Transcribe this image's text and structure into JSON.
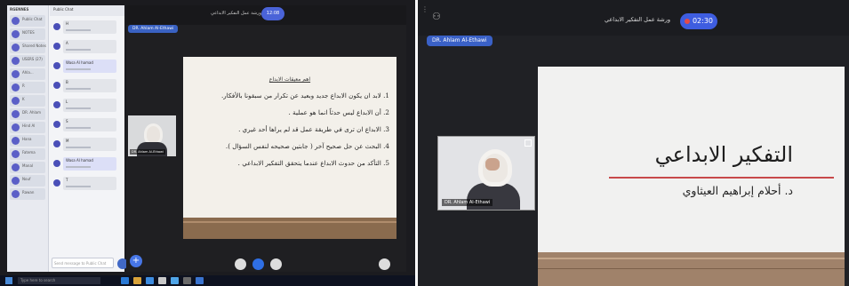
{
  "left": {
    "sidebar": {
      "rail_header": "RGENNES",
      "rail_items": [
        {
          "label": "Public Chat"
        },
        {
          "label": "NOTES"
        },
        {
          "label": "Shared Notes"
        },
        {
          "label": "USERS (27)"
        },
        {
          "label": "Ahla..."
        },
        {
          "label": "R"
        },
        {
          "label": "K"
        },
        {
          "label": "DR. Ahlam"
        },
        {
          "label": "Hind Al"
        },
        {
          "label": "Hana"
        },
        {
          "label": "Fatema"
        },
        {
          "label": "Manal"
        },
        {
          "label": "Nouf"
        },
        {
          "label": "Rawan"
        }
      ],
      "chat_title": "Public Chat",
      "messages": [
        {
          "name": "H",
          "rich": false
        },
        {
          "name": "A",
          "rich": false
        },
        {
          "name": "Wasa Al hamad",
          "rich": true
        },
        {
          "name": "B",
          "rich": false
        },
        {
          "name": "L",
          "rich": false
        },
        {
          "name": "S",
          "rich": false
        },
        {
          "name": "M",
          "rich": false
        },
        {
          "name": "Wasa Al hamad",
          "rich": true
        },
        {
          "name": "T",
          "rich": false
        }
      ],
      "compose_placeholder": "Send message to Public Chat"
    },
    "meeting": {
      "title": "ورشة عمل التفكير الابداعي",
      "timer": "12:08",
      "presenter": "DR. Ahlam Al-Ethawi",
      "camera_label": "DR. Ahlam Al-Ethawi",
      "slide": {
        "title": "اهم معيقات الابداع",
        "points": [
          "1. لابد ان يكون الابداع جديد وبعيد عن تكرار من سبقونا بالأفكار.",
          "2. أن الابداع ليس حدثاً انما هو عملية .",
          "3. الابداع ان ترى في طريقة عمل قد لم يراها أحد غيري .",
          "4. البحث عن حل صحيح آخر ( جابتين صحيحه لنفس السؤال ).",
          "5. التأكد من حدوث الابداع عندما يتحقق التفكير الابداعي ."
        ]
      }
    },
    "taskbar": {
      "search_placeholder": "Type here to search"
    }
  },
  "right": {
    "meeting": {
      "title": "ورشة عمل التفكير الابداعي",
      "timer": "02:30",
      "presenter": "DR. Ahlam Al-Ethawi",
      "camera_label": "DR. Ahlam Al-Ethawi",
      "slide": {
        "title": "التفكير الابداعي",
        "subtitle": "د. أحلام إبراهيم العيثاوي"
      }
    }
  }
}
